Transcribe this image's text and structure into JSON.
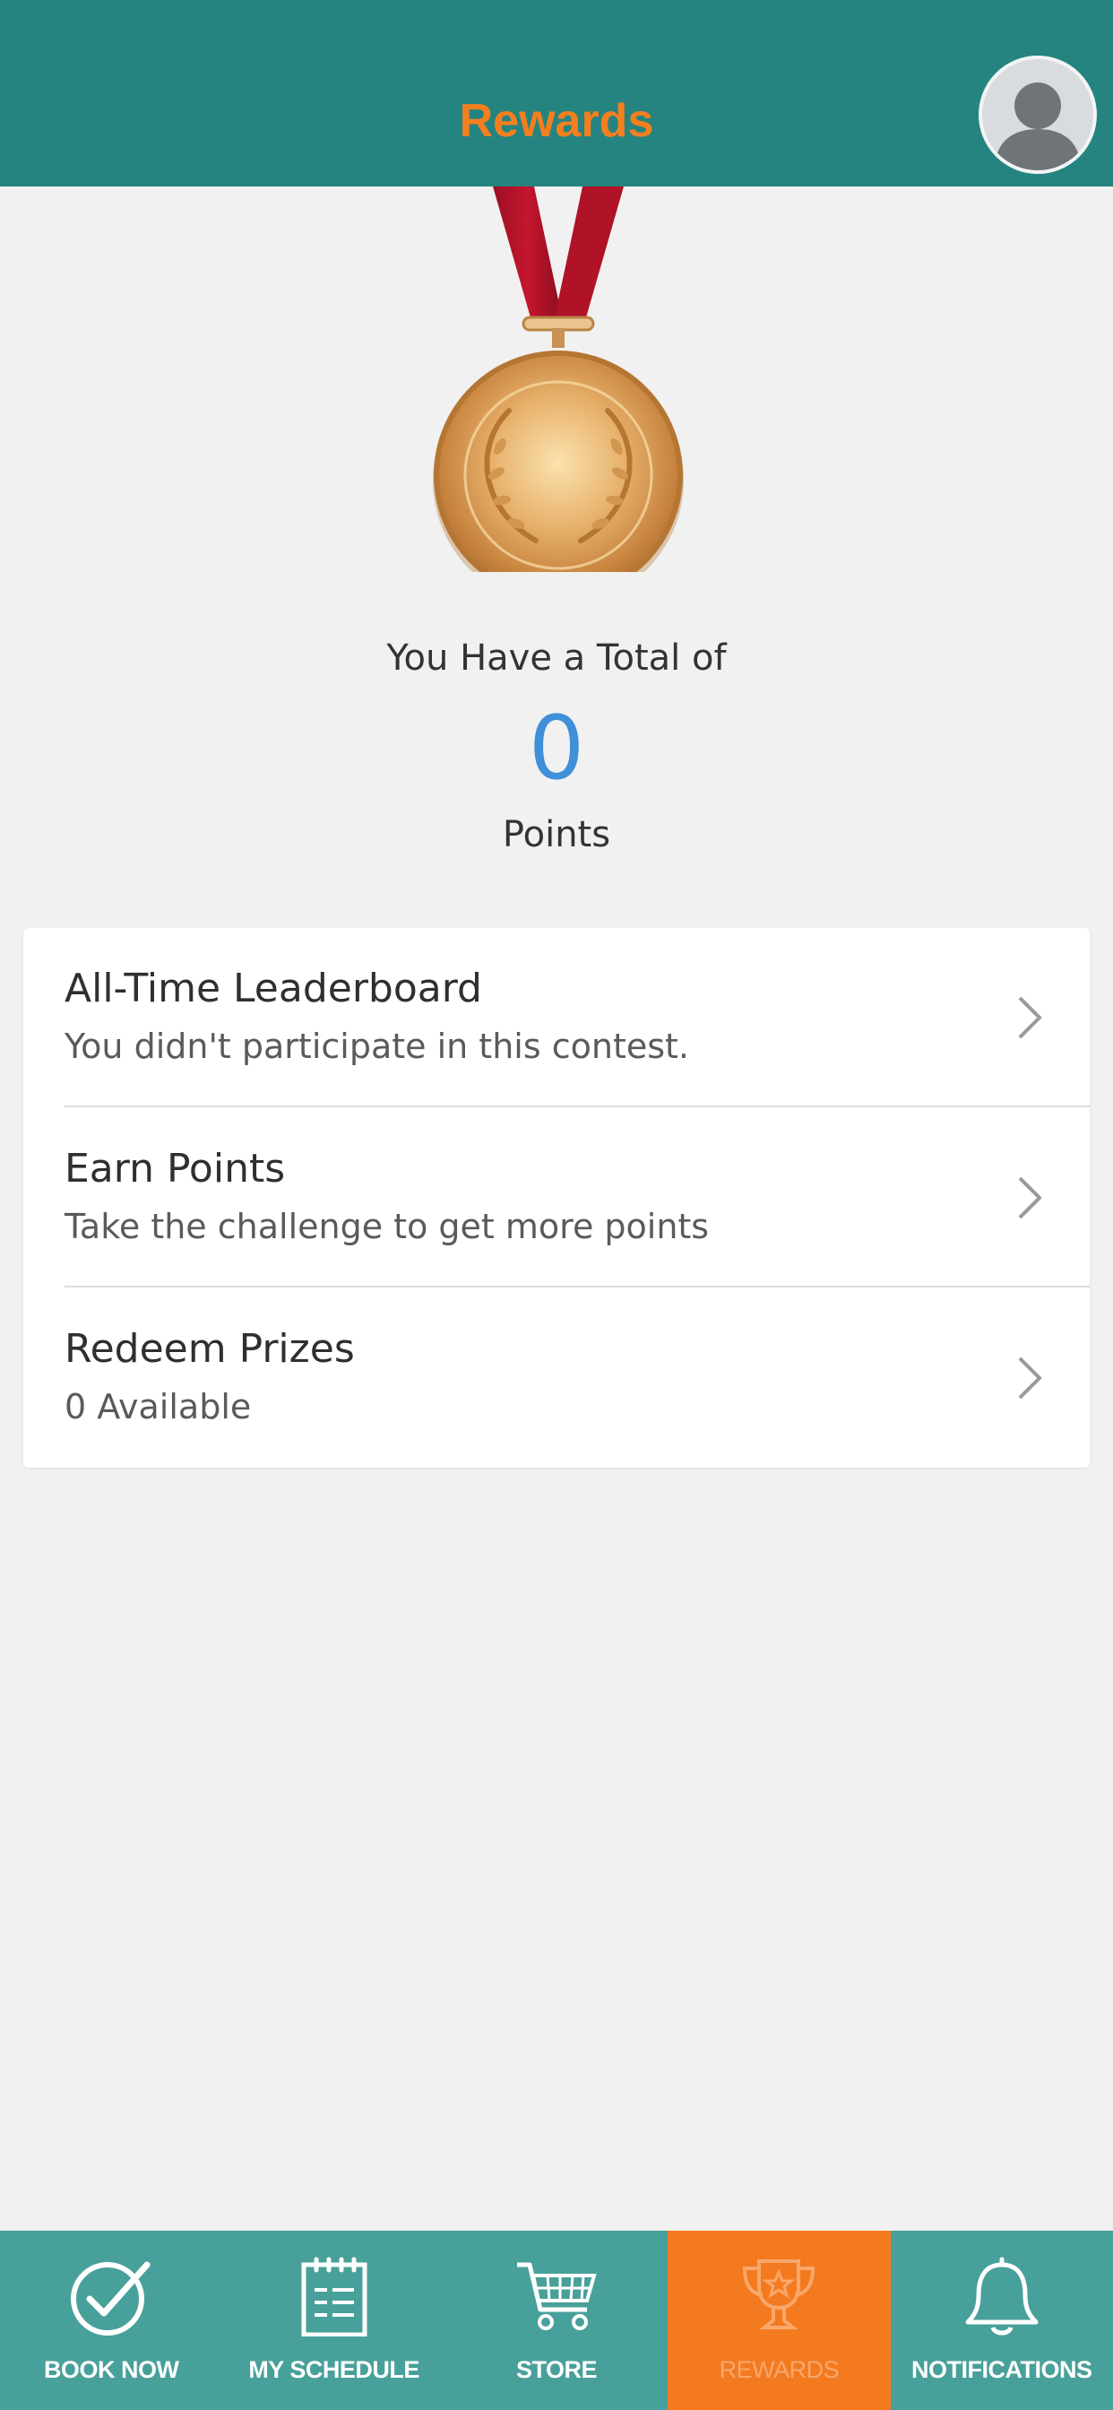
{
  "header": {
    "title": "Rewards"
  },
  "summary": {
    "total_label": "You Have a Total of",
    "points_value": "0",
    "points_label": "Points"
  },
  "list": [
    {
      "title": "All-Time Leaderboard",
      "subtitle": "You didn't participate in this contest."
    },
    {
      "title": "Earn Points",
      "subtitle": "Take the challenge to get more points"
    },
    {
      "title": "Redeem Prizes",
      "subtitle": "0 Available"
    }
  ],
  "tabs": [
    {
      "label": "BOOK NOW",
      "icon": "check-circle-icon",
      "active": false
    },
    {
      "label": "MY SCHEDULE",
      "icon": "calendar-icon",
      "active": false
    },
    {
      "label": "STORE",
      "icon": "cart-icon",
      "active": false
    },
    {
      "label": "REWARDS",
      "icon": "trophy-icon",
      "active": true
    },
    {
      "label": "NOTIFICATIONS",
      "icon": "bell-icon",
      "active": false
    }
  ],
  "colors": {
    "header_bg": "#25847f",
    "accent_orange": "#f47a20",
    "points_blue": "#3f8fd9",
    "tabbar_bg": "#48a09a"
  }
}
